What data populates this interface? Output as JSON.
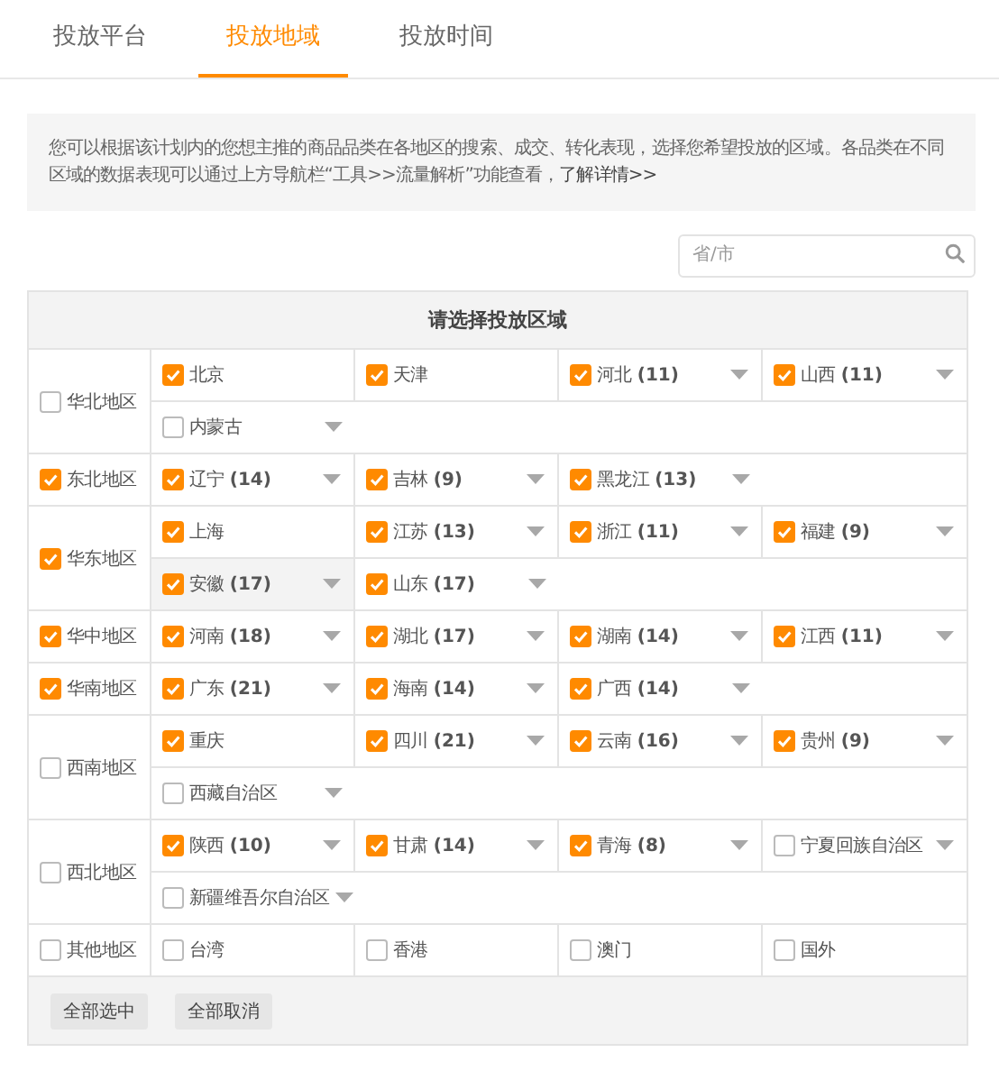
{
  "tabs": [
    {
      "label": "投放平台",
      "selected": false
    },
    {
      "label": "投放地域",
      "selected": true
    },
    {
      "label": "投放时间",
      "selected": false
    }
  ],
  "notice": {
    "text": "您可以根据该计划内的您想主推的商品品类在各地区的搜索、成交、转化表现，选择您希望投放的区域。各品类在不同区域的数据表现可以通过上方导航栏“工具>>流量解析”功能查看，",
    "link": "了解详情>>"
  },
  "search": {
    "placeholder": "省/市"
  },
  "table": {
    "title": "请选择投放区域",
    "regions": [
      {
        "name": "华北地区",
        "checked": false,
        "provinces": [
          {
            "name": "北京",
            "checked": true,
            "dropdown": false,
            "hovered": false
          },
          {
            "name": "天津",
            "checked": true,
            "dropdown": false,
            "hovered": false
          },
          {
            "name": "河北",
            "count": "(11)",
            "checked": true,
            "dropdown": true,
            "hovered": false
          },
          {
            "name": "山西",
            "count": "(11)",
            "checked": true,
            "dropdown": true,
            "hovered": false
          },
          {
            "name": "内蒙古",
            "checked": false,
            "dropdown": true,
            "hovered": false
          }
        ]
      },
      {
        "name": "东北地区",
        "checked": true,
        "provinces": [
          {
            "name": "辽宁",
            "count": "(14)",
            "checked": true,
            "dropdown": true,
            "hovered": false
          },
          {
            "name": "吉林",
            "count": "(9)",
            "checked": true,
            "dropdown": true,
            "hovered": false
          },
          {
            "name": "黑龙江",
            "count": "(13)",
            "checked": true,
            "dropdown": true,
            "hovered": false
          }
        ]
      },
      {
        "name": "华东地区",
        "checked": true,
        "provinces": [
          {
            "name": "上海",
            "checked": true,
            "dropdown": false,
            "hovered": false
          },
          {
            "name": "江苏",
            "count": "(13)",
            "checked": true,
            "dropdown": true,
            "hovered": false
          },
          {
            "name": "浙江",
            "count": "(11)",
            "checked": true,
            "dropdown": true,
            "hovered": false
          },
          {
            "name": "福建",
            "count": "(9)",
            "checked": true,
            "dropdown": true,
            "hovered": false
          },
          {
            "name": "安徽",
            "count": "(17)",
            "checked": true,
            "dropdown": true,
            "hovered": true
          },
          {
            "name": "山东",
            "count": "(17)",
            "checked": true,
            "dropdown": true,
            "hovered": false
          }
        ]
      },
      {
        "name": "华中地区",
        "checked": true,
        "provinces": [
          {
            "name": "河南",
            "count": "(18)",
            "checked": true,
            "dropdown": true,
            "hovered": false
          },
          {
            "name": "湖北",
            "count": "(17)",
            "checked": true,
            "dropdown": true,
            "hovered": false
          },
          {
            "name": "湖南",
            "count": "(14)",
            "checked": true,
            "dropdown": true,
            "hovered": false
          },
          {
            "name": "江西",
            "count": "(11)",
            "checked": true,
            "dropdown": true,
            "hovered": false
          }
        ]
      },
      {
        "name": "华南地区",
        "checked": true,
        "provinces": [
          {
            "name": "广东",
            "count": "(21)",
            "checked": true,
            "dropdown": true,
            "hovered": false
          },
          {
            "name": "海南",
            "count": "(14)",
            "checked": true,
            "dropdown": true,
            "hovered": false
          },
          {
            "name": "广西",
            "count": "(14)",
            "checked": true,
            "dropdown": true,
            "hovered": false
          }
        ]
      },
      {
        "name": "西南地区",
        "checked": false,
        "provinces": [
          {
            "name": "重庆",
            "checked": true,
            "dropdown": false,
            "hovered": false
          },
          {
            "name": "四川",
            "count": "(21)",
            "checked": true,
            "dropdown": true,
            "hovered": false
          },
          {
            "name": "云南",
            "count": "(16)",
            "checked": true,
            "dropdown": true,
            "hovered": false
          },
          {
            "name": "贵州",
            "count": "(9)",
            "checked": true,
            "dropdown": true,
            "hovered": false
          },
          {
            "name": "西藏自治区",
            "checked": false,
            "dropdown": true,
            "hovered": false
          }
        ]
      },
      {
        "name": "西北地区",
        "checked": false,
        "provinces": [
          {
            "name": "陕西",
            "count": "(10)",
            "checked": true,
            "dropdown": true,
            "hovered": false
          },
          {
            "name": "甘肃",
            "count": "(14)",
            "checked": true,
            "dropdown": true,
            "hovered": false
          },
          {
            "name": "青海",
            "count": "(8)",
            "checked": true,
            "dropdown": true,
            "hovered": false
          },
          {
            "name": "宁夏回族自治区",
            "checked": false,
            "dropdown": true,
            "hovered": false
          },
          {
            "name": "新疆维吾尔自治区",
            "checked": false,
            "dropdown": true,
            "hovered": false
          }
        ]
      },
      {
        "name": "其他地区",
        "checked": false,
        "provinces": [
          {
            "name": "台湾",
            "checked": false,
            "dropdown": false,
            "hovered": false
          },
          {
            "name": "香港",
            "checked": false,
            "dropdown": false,
            "hovered": false
          },
          {
            "name": "澳门",
            "checked": false,
            "dropdown": false,
            "hovered": false
          },
          {
            "name": "国外",
            "checked": false,
            "dropdown": false,
            "hovered": false
          }
        ]
      }
    ],
    "buttons": [
      "全部选中",
      "全部取消"
    ]
  }
}
